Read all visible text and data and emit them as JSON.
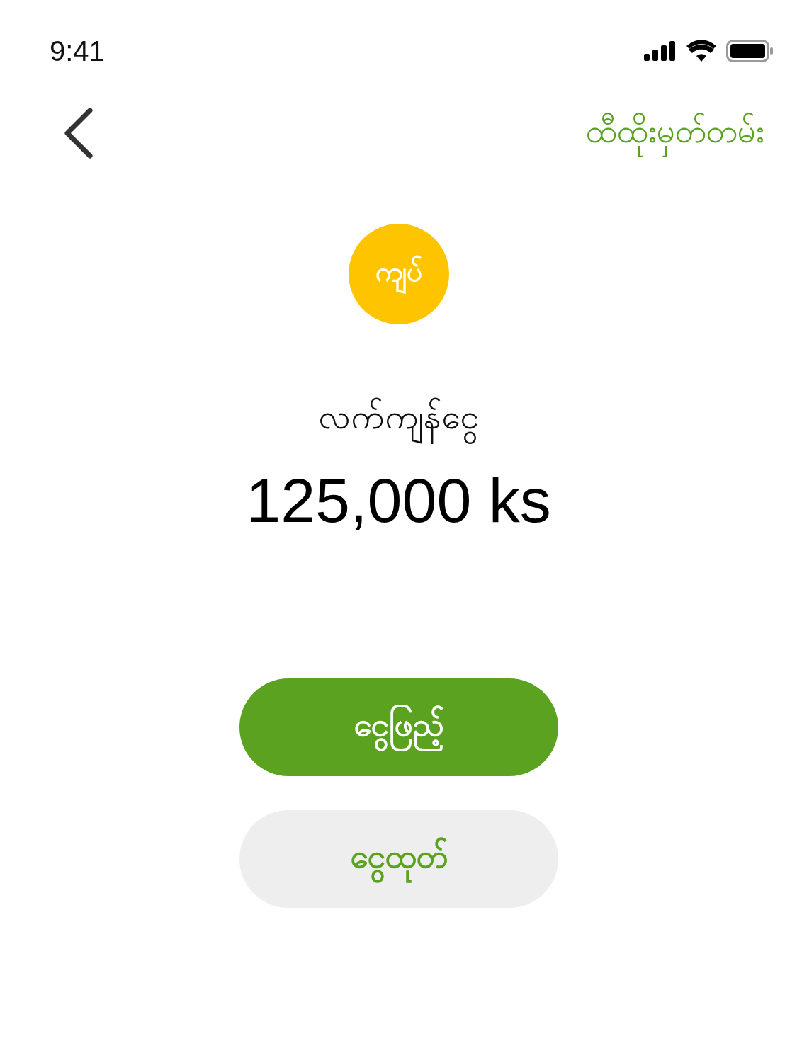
{
  "status_bar": {
    "time": "9:41"
  },
  "header": {
    "title": "ထီထိုးမှတ်တမ်း"
  },
  "balance": {
    "logo_text": "ကျပ်",
    "label": "လက်ကျန်ငွေ",
    "amount": "125,000 ks"
  },
  "buttons": [
    {
      "label": "ငွေဖြည့်",
      "kind": "primary"
    },
    {
      "label": "ငွေထုတ်",
      "kind": "secondary"
    }
  ]
}
